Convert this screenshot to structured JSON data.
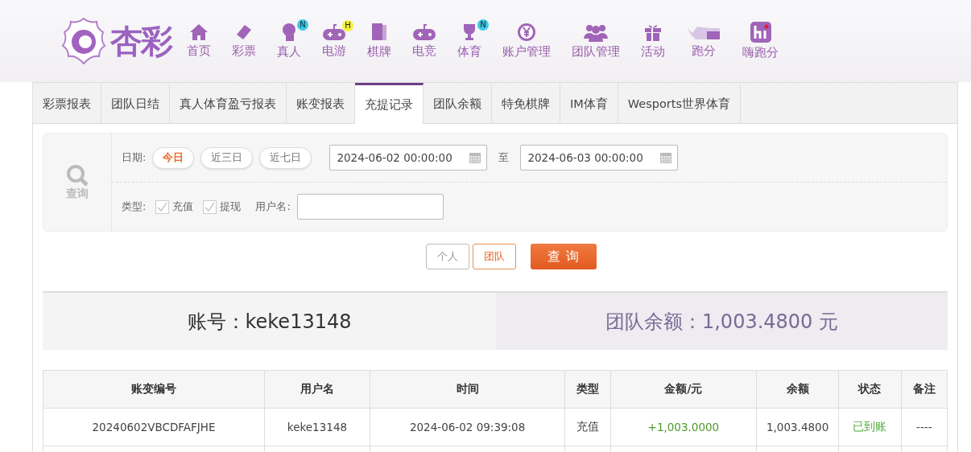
{
  "logo": {
    "text": "杏彩"
  },
  "nav": [
    {
      "label": "首页"
    },
    {
      "label": "彩票"
    },
    {
      "label": "真人",
      "badge": "N",
      "color": "#3cc8e8"
    },
    {
      "label": "电游",
      "badge": "H",
      "color": "#f5f03a"
    },
    {
      "label": "棋牌"
    },
    {
      "label": "电竞"
    },
    {
      "label": "体育",
      "badge": "N",
      "color": "#3cc8e8"
    },
    {
      "label": "账户管理"
    },
    {
      "label": "团队管理"
    },
    {
      "label": "活动"
    },
    {
      "label": "跑分"
    },
    {
      "label": "嗨跑分"
    }
  ],
  "tabs": [
    {
      "label": "彩票报表",
      "selected": false
    },
    {
      "label": "团队日结",
      "selected": false
    },
    {
      "label": "真人体育盈亏报表",
      "selected": false
    },
    {
      "label": "账变报表",
      "selected": false
    },
    {
      "label": "充提记录",
      "selected": true
    },
    {
      "label": "团队余额",
      "selected": false
    },
    {
      "label": "特免棋牌",
      "selected": false
    },
    {
      "label": "IM体育",
      "selected": false
    },
    {
      "label": "Wesports世界体育",
      "selected": false
    }
  ],
  "filter": {
    "search_label": "查询",
    "date_label": "日期:",
    "quick_ranges": [
      {
        "label": "今日",
        "selected": true
      },
      {
        "label": "近三日",
        "selected": false
      },
      {
        "label": "近七日",
        "selected": false
      }
    ],
    "start": "2024-06-02 00:00:00",
    "to": "至",
    "end": "2024-06-03 00:00:00",
    "type_label": "类型:",
    "types": [
      {
        "label": "充值",
        "checked": true
      },
      {
        "label": "提现",
        "checked": true
      }
    ],
    "username_label": "用户名:"
  },
  "scope": [
    {
      "label": "个人",
      "selected": false
    },
    {
      "label": "团队",
      "selected": true
    }
  ],
  "query_button": "查 询",
  "summary": {
    "account": "账号：keke13148",
    "balance": "团队余额：1,003.4800 元"
  },
  "table": {
    "columns": [
      "账变编号",
      "用户名",
      "时间",
      "类型",
      "金额/元",
      "余额",
      "状态",
      "备注"
    ],
    "rows": [
      [
        "20240602VBCDFAFJHE",
        "keke13148",
        "2024-06-02 09:39:08",
        "充值",
        "+1,003.0000",
        "1,003.4800",
        "已到账",
        "----"
      ]
    ]
  }
}
